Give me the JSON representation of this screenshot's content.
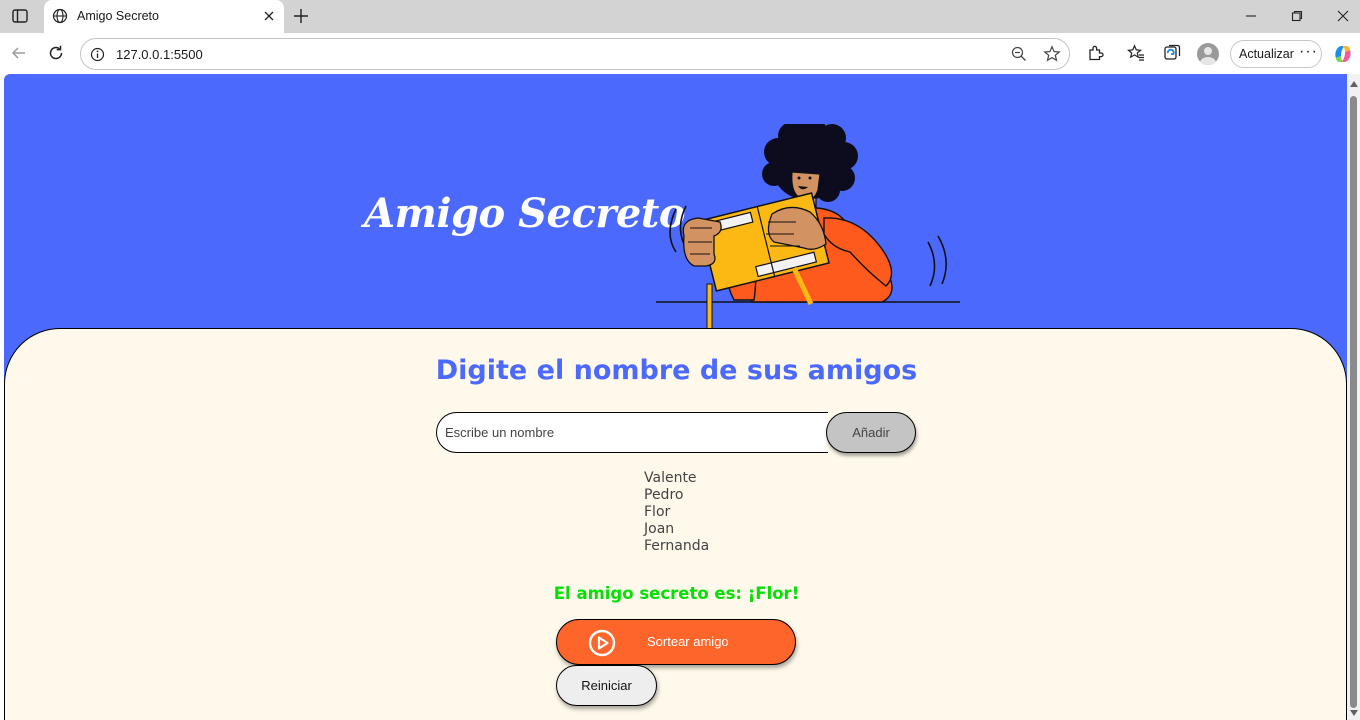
{
  "browser": {
    "tab_title": "Amigo Secreto",
    "url": "127.0.0.1:5500",
    "update_label": "Actualizar",
    "more_label": "···",
    "icons": [
      "tab-panel-icon",
      "globe-icon",
      "close-icon",
      "new-tab-icon",
      "minimize-icon",
      "restore-icon",
      "window-close-icon",
      "back-icon",
      "reload-icon",
      "info-icon",
      "zoom-out-icon",
      "favorite-star-icon",
      "extensions-icon",
      "favorites-icon",
      "collections-icon",
      "profile-icon",
      "copilot-icon"
    ]
  },
  "header": {
    "title": "Amigo Secreto",
    "illustration": "person-opening-gift-box"
  },
  "main": {
    "section_title": "Digite el nombre de sus amigos",
    "input_placeholder": "Escribe un nombre",
    "add_button": "Añadir",
    "friends": [
      "Valente",
      "Pedro",
      "Flor",
      "Joan",
      "Fernanda"
    ],
    "result": "El amigo secreto es: ¡Flor!",
    "draw_button": "Sortear amigo",
    "reset_button": "Reiniciar"
  },
  "colors": {
    "header_bg": "#4b69fd",
    "main_bg": "#fff9eb",
    "title_blue": "#4b69fd",
    "result_green": "#05df05",
    "draw_orange": "#fe652b",
    "add_gray": "#c4c4c4"
  }
}
